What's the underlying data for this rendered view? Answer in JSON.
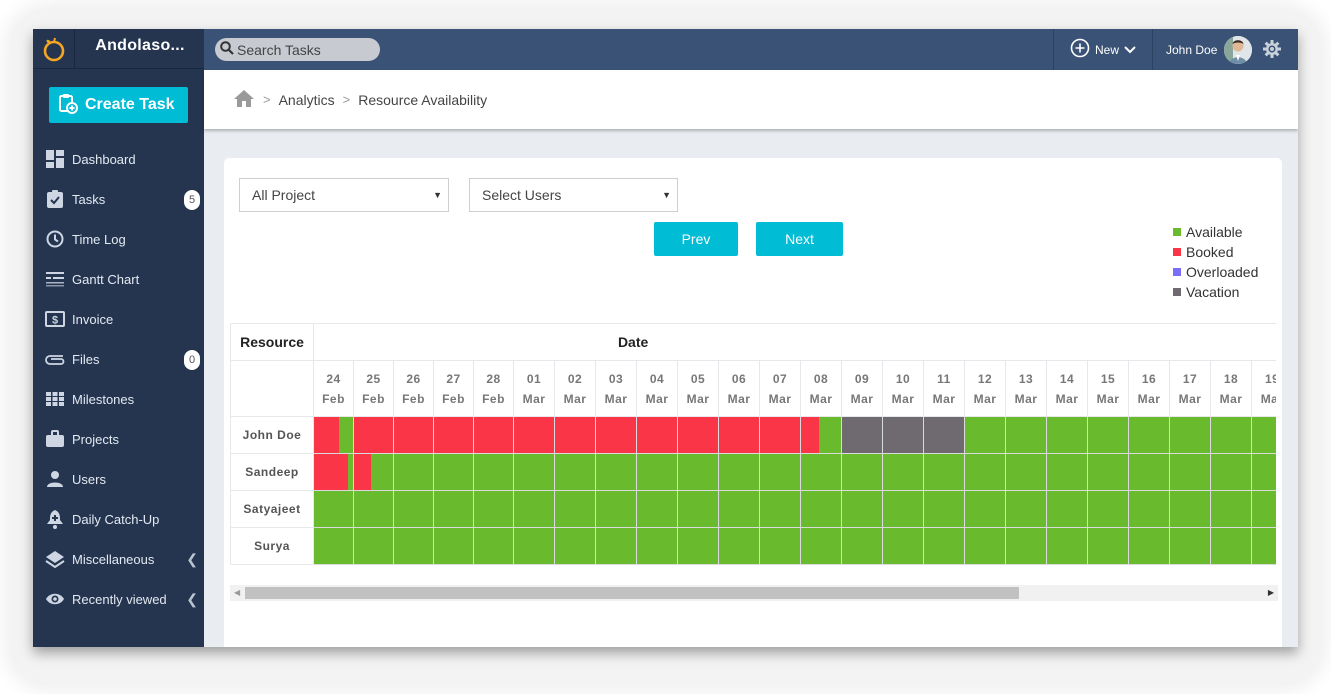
{
  "app": {
    "brand_name": "Andolaso...",
    "create_task_label": "Create Task",
    "search_placeholder": "Search Tasks",
    "new_label": "New",
    "user_name": "John Doe"
  },
  "sidebar": {
    "items": [
      {
        "label": "Dashboard",
        "icon": "dashboard-icon"
      },
      {
        "label": "Tasks",
        "icon": "clipboard-check-icon",
        "badge": "5"
      },
      {
        "label": "Time Log",
        "icon": "clock-icon"
      },
      {
        "label": "Gantt Chart",
        "icon": "gantt-icon"
      },
      {
        "label": "Invoice",
        "icon": "invoice-dollar-icon"
      },
      {
        "label": "Files",
        "icon": "paperclip-icon",
        "badge": "0"
      },
      {
        "label": "Milestones",
        "icon": "grid-icon"
      },
      {
        "label": "Projects",
        "icon": "briefcase-icon"
      },
      {
        "label": "Users",
        "icon": "user-icon"
      },
      {
        "label": "Daily Catch-Up",
        "icon": "bell-plus-icon"
      },
      {
        "label": "Miscellaneous",
        "icon": "layers-icon",
        "expandable": true
      },
      {
        "label": "Recently viewed",
        "icon": "eye-icon",
        "expandable": true
      }
    ]
  },
  "breadcrumb": {
    "items": [
      "Analytics",
      "Resource Availability"
    ]
  },
  "filters": {
    "project_select": "All Project",
    "users_select": "Select Users",
    "prev_label": "Prev",
    "next_label": "Next"
  },
  "legend": [
    {
      "label": "Available",
      "color": "#6aba2e"
    },
    {
      "label": "Booked",
      "color": "#fb3548"
    },
    {
      "label": "Overloaded",
      "color": "#7b6ef6"
    },
    {
      "label": "Vacation",
      "color": "#6f6a70"
    }
  ],
  "table": {
    "resource_header": "Resource",
    "date_header": "Date",
    "days": [
      {
        "d": "24",
        "m": "Feb"
      },
      {
        "d": "25",
        "m": "Feb"
      },
      {
        "d": "26",
        "m": "Feb"
      },
      {
        "d": "27",
        "m": "Feb"
      },
      {
        "d": "28",
        "m": "Feb"
      },
      {
        "d": "01",
        "m": "Mar"
      },
      {
        "d": "02",
        "m": "Mar"
      },
      {
        "d": "03",
        "m": "Mar"
      },
      {
        "d": "04",
        "m": "Mar"
      },
      {
        "d": "05",
        "m": "Mar"
      },
      {
        "d": "06",
        "m": "Mar"
      },
      {
        "d": "07",
        "m": "Mar"
      },
      {
        "d": "08",
        "m": "Mar"
      },
      {
        "d": "09",
        "m": "Mar"
      },
      {
        "d": "10",
        "m": "Mar"
      },
      {
        "d": "11",
        "m": "Mar"
      },
      {
        "d": "12",
        "m": "Mar"
      },
      {
        "d": "13",
        "m": "Mar"
      },
      {
        "d": "14",
        "m": "Mar"
      },
      {
        "d": "15",
        "m": "Mar"
      },
      {
        "d": "16",
        "m": "Mar"
      },
      {
        "d": "17",
        "m": "Mar"
      },
      {
        "d": "18",
        "m": "Mar"
      },
      {
        "d": "19",
        "m": "Mar"
      }
    ],
    "resources": [
      {
        "name": "John Doe",
        "days": [
          [
            {
              "s": "booked",
              "f": 0.65
            },
            {
              "s": "available",
              "f": 0.35
            }
          ],
          [
            {
              "s": "booked",
              "f": 1
            }
          ],
          [
            {
              "s": "booked",
              "f": 1
            }
          ],
          [
            {
              "s": "booked",
              "f": 1
            }
          ],
          [
            {
              "s": "booked",
              "f": 1
            }
          ],
          [
            {
              "s": "booked",
              "f": 1
            }
          ],
          [
            {
              "s": "booked",
              "f": 1
            }
          ],
          [
            {
              "s": "booked",
              "f": 1
            }
          ],
          [
            {
              "s": "booked",
              "f": 1
            }
          ],
          [
            {
              "s": "booked",
              "f": 1
            }
          ],
          [
            {
              "s": "booked",
              "f": 1
            }
          ],
          [
            {
              "s": "booked",
              "f": 1
            }
          ],
          [
            {
              "s": "booked",
              "f": 0.45
            },
            {
              "s": "available",
              "f": 0.55
            }
          ],
          [
            {
              "s": "vacation",
              "f": 1
            }
          ],
          [
            {
              "s": "vacation",
              "f": 1
            }
          ],
          [
            {
              "s": "vacation",
              "f": 1
            }
          ],
          [
            {
              "s": "available",
              "f": 1
            }
          ],
          [
            {
              "s": "available",
              "f": 1
            }
          ],
          [
            {
              "s": "available",
              "f": 1
            }
          ],
          [
            {
              "s": "available",
              "f": 1
            }
          ],
          [
            {
              "s": "available",
              "f": 1
            }
          ],
          [
            {
              "s": "available",
              "f": 1
            }
          ],
          [
            {
              "s": "available",
              "f": 1
            }
          ],
          [
            {
              "s": "available",
              "f": 1
            }
          ]
        ]
      },
      {
        "name": "Sandeep",
        "days": [
          [
            {
              "s": "booked",
              "f": 0.88
            },
            {
              "s": "available",
              "f": 0.12
            }
          ],
          [
            {
              "s": "booked",
              "f": 0.43
            },
            {
              "s": "available",
              "f": 0.57
            }
          ],
          [
            {
              "s": "available",
              "f": 1
            }
          ],
          [
            {
              "s": "available",
              "f": 1
            }
          ],
          [
            {
              "s": "available",
              "f": 1
            }
          ],
          [
            {
              "s": "available",
              "f": 1
            }
          ],
          [
            {
              "s": "available",
              "f": 1
            }
          ],
          [
            {
              "s": "available",
              "f": 1
            }
          ],
          [
            {
              "s": "available",
              "f": 1
            }
          ],
          [
            {
              "s": "available",
              "f": 1
            }
          ],
          [
            {
              "s": "available",
              "f": 1
            }
          ],
          [
            {
              "s": "available",
              "f": 1
            }
          ],
          [
            {
              "s": "available",
              "f": 1
            }
          ],
          [
            {
              "s": "available",
              "f": 1
            }
          ],
          [
            {
              "s": "available",
              "f": 1
            }
          ],
          [
            {
              "s": "available",
              "f": 1
            }
          ],
          [
            {
              "s": "available",
              "f": 1
            }
          ],
          [
            {
              "s": "available",
              "f": 1
            }
          ],
          [
            {
              "s": "available",
              "f": 1
            }
          ],
          [
            {
              "s": "available",
              "f": 1
            }
          ],
          [
            {
              "s": "available",
              "f": 1
            }
          ],
          [
            {
              "s": "available",
              "f": 1
            }
          ],
          [
            {
              "s": "available",
              "f": 1
            }
          ],
          [
            {
              "s": "available",
              "f": 1
            }
          ]
        ]
      },
      {
        "name": "Satyajeet",
        "days": "all-available"
      },
      {
        "name": "Surya",
        "days": "all-available"
      }
    ]
  },
  "status_colors": {
    "available": "#6aba2e",
    "booked": "#fb3548",
    "overloaded": "#7b6ef6",
    "vacation": "#6f6a70"
  },
  "scrollbar": {
    "position_fraction": 0.0,
    "visible_fraction": 0.76
  }
}
